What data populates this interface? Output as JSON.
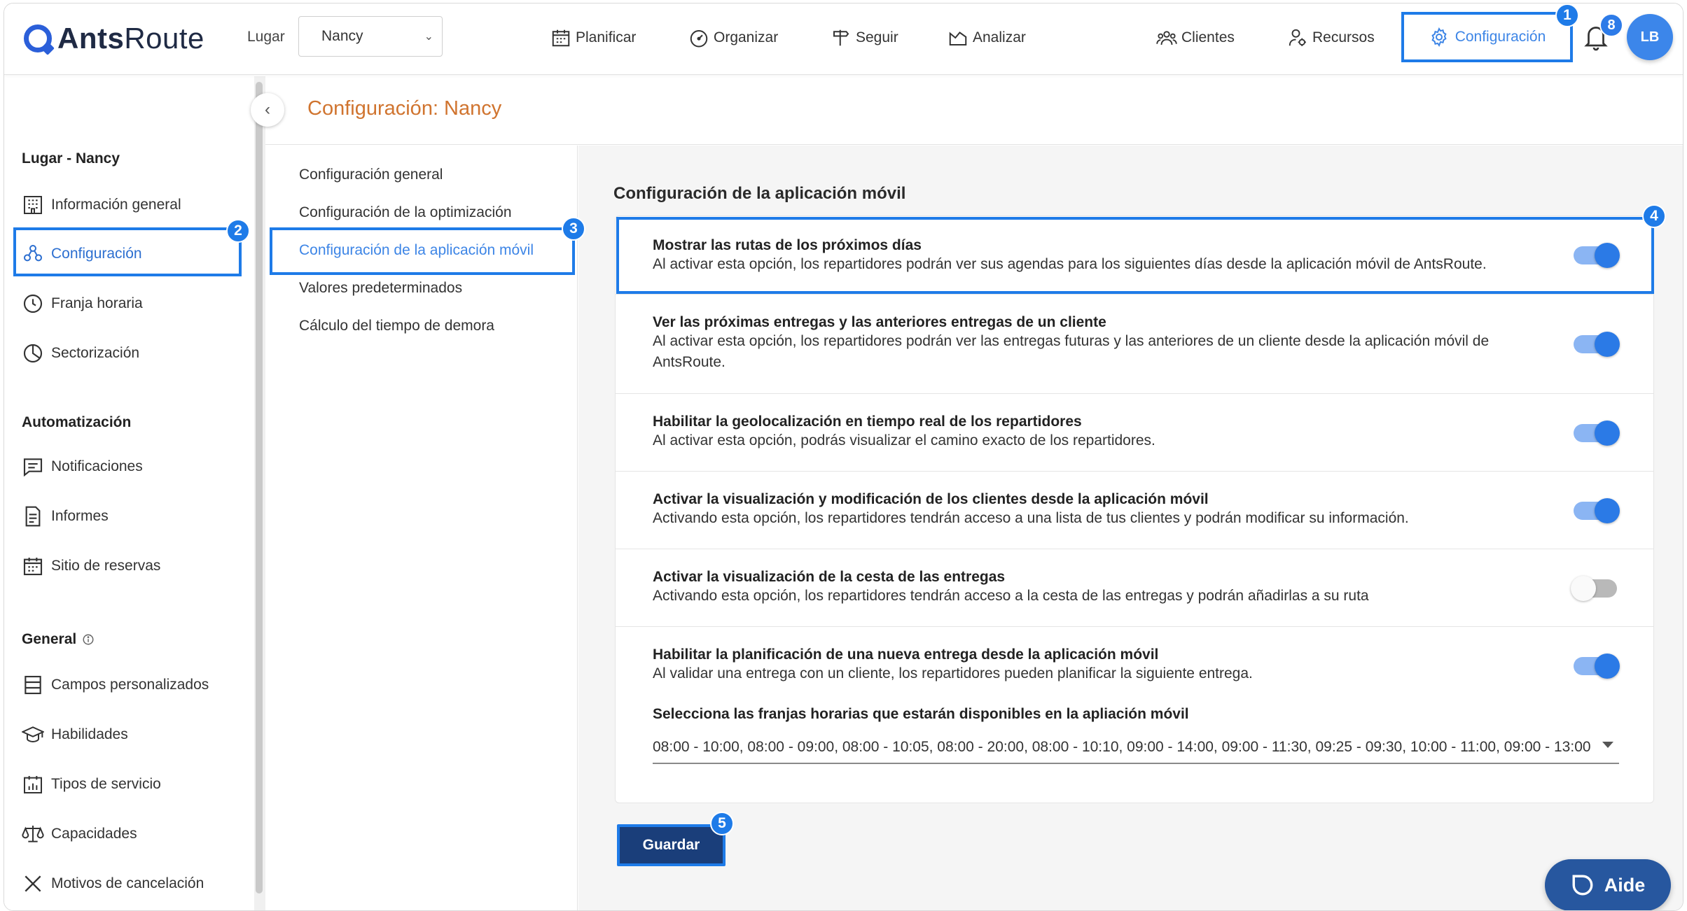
{
  "app": {
    "logo_bold": "Ants",
    "logo_light": "Route"
  },
  "topbar": {
    "lugar_label": "Lugar",
    "lugar_value": "Nancy",
    "nav": [
      {
        "label": "Planificar",
        "icon": "calendar-icon"
      },
      {
        "label": "Organizar",
        "icon": "gauge-icon"
      },
      {
        "label": "Seguir",
        "icon": "signpost-icon"
      },
      {
        "label": "Analizar",
        "icon": "chart-icon"
      },
      {
        "label": "Clientes",
        "icon": "users-icon"
      },
      {
        "label": "Recursos",
        "icon": "user-gear-icon"
      }
    ],
    "config_label": "Configuración",
    "notifications_count": "8",
    "avatar_initials": "LB"
  },
  "markers": {
    "m1": "1",
    "m2": "2",
    "m3": "3",
    "m4": "4",
    "m5": "5"
  },
  "sidebar": {
    "section_lugar": "Lugar - Nancy",
    "lugar_items": [
      "Información general",
      "Configuración",
      "Franja horaria",
      "Sectorización"
    ],
    "section_auto": "Automatización",
    "auto_items": [
      "Notificaciones",
      "Informes",
      "Sitio de reservas"
    ],
    "section_general": "General",
    "general_items": [
      "Campos personalizados",
      "Habilidades",
      "Tipos de servicio",
      "Capacidades",
      "Motivos de cancelación"
    ]
  },
  "page": {
    "title": "Configuración: Nancy"
  },
  "submenu": [
    "Configuración general",
    "Configuración de la optimización",
    "Configuración de la aplicación móvil",
    "Valores predeterminados",
    "Cálculo del tiempo de demora"
  ],
  "content": {
    "section_title": "Configuración de la aplicación móvil",
    "options": [
      {
        "title": "Mostrar las rutas de los próximos días",
        "desc": "Al activar esta opción, los repartidores podrán ver sus agendas para los siguientes días desde la aplicación móvil de AntsRoute.",
        "enabled": true
      },
      {
        "title": "Ver las próximas entregas y las anteriores entregas de un cliente",
        "desc": "Al activar esta opción, los repartidores podrán ver las entregas futuras y las anteriores de un cliente desde la aplicación móvil de AntsRoute.",
        "enabled": true
      },
      {
        "title": "Habilitar la geolocalización en tiempo real de los repartidores",
        "desc": "Al activar esta opción, podrás visualizar el camino exacto de los repartidores.",
        "enabled": true
      },
      {
        "title": "Activar la visualización y modificación de los clientes desde la aplicación móvil",
        "desc": "Activando esta opción, los repartidores tendrán acceso a una lista de tus clientes y podrán modificar su información.",
        "enabled": true
      },
      {
        "title": "Activar la visualización de la cesta de las entregas",
        "desc": "Activando esta opción, los repartidores tendrán acceso a la cesta de las entregas y podrán añadirlas a su ruta",
        "enabled": false
      },
      {
        "title": "Habilitar la planificación de una nueva entrega desde la aplicación móvil",
        "desc": "Al validar una entrega con un cliente, los repartidores pueden planificar la siguiente entrega.",
        "enabled": true
      }
    ],
    "slots_label": "Selecciona las franjas horarias que estarán disponibles en la apliación móvil",
    "slots_value": "08:00 - 10:00, 08:00 - 09:00, 08:00 - 10:05, 08:00 - 20:00, 08:00 - 10:10, 09:00 - 14:00, 09:00 - 11:30, 09:25 - 09:30, 10:00 - 11:00, 09:00 - 13:00, ...",
    "save_label": "Guardar"
  },
  "help": {
    "label": "Aide"
  },
  "colors": {
    "accent": "#1e7be8",
    "title_orange": "#d0742f",
    "save_bg": "#1a3e7a",
    "help_bg": "#27579f"
  }
}
